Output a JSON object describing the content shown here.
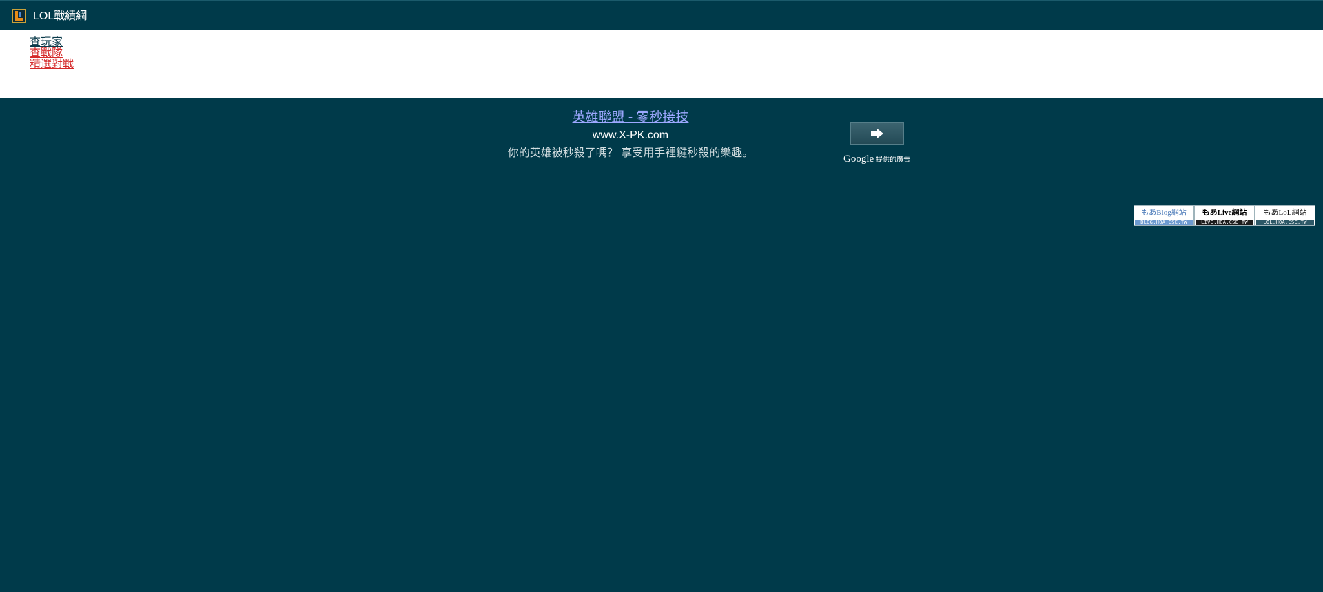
{
  "header": {
    "logo_icon": "lol-logo-icon",
    "title": "LOL戰績網"
  },
  "nav": {
    "items": [
      {
        "label": "查玩家"
      },
      {
        "label": "查戰隊"
      },
      {
        "label": "精選對戰"
      }
    ]
  },
  "ad": {
    "title": "英雄聯盟 - 零秒接技",
    "url": "www.X-PK.com",
    "description": "你的英雄被秒殺了嗎？ 享受用手裡鍵秒殺的樂趣。",
    "button_icon": "arrow-right-icon",
    "attribution_brand": "Google",
    "attribution_suffix": "提供的廣告"
  },
  "badges": [
    {
      "top": "もあBlog網站",
      "bottom": "BLOG.HOA.CSE.TW"
    },
    {
      "top": "もあLive網站",
      "bottom": "LIVE.HOA.CSE.TW"
    },
    {
      "top": "もあLoL網站",
      "bottom": "LOL.HOA.CSE.TW"
    }
  ],
  "colors": {
    "background": "#003a4a",
    "nav_background": "#ffffff",
    "nav_link_primary": "#0a3a4a",
    "nav_link_secondary": "#d52a2a",
    "ad_title": "#9da8ff"
  }
}
